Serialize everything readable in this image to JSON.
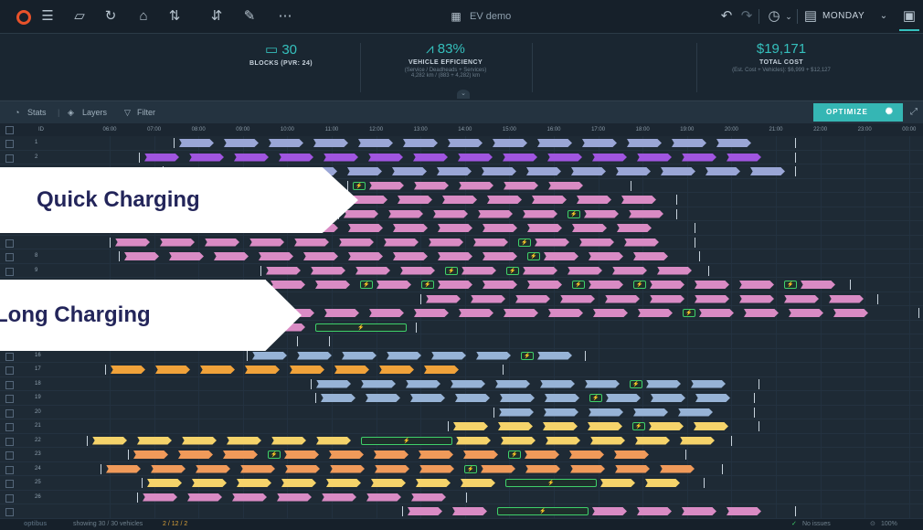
{
  "topbar": {
    "title": "EV demo",
    "day": "MONDAY",
    "icons": [
      "logo-icon",
      "menu-icon",
      "folder-icon",
      "refresh-icon",
      "building-icon",
      "sort-icon",
      "number-sort-icon",
      "pencil-icon",
      "more-icon"
    ],
    "right_icons": [
      "undo-icon",
      "redo-icon",
      "clock-icon",
      "document-icon",
      "bus-icon"
    ]
  },
  "stats": {
    "blocks": {
      "value": "30",
      "label": "BLOCKS (PVR: 24)"
    },
    "efficiency": {
      "value": "83%",
      "label": "VEHICLE EFFICIENCY",
      "sub1": "(Service / Deadheads + Services)",
      "sub2": "4,282 km / (883 + 4,282) km"
    },
    "cost": {
      "value": "$19,171",
      "label": "TOTAL COST",
      "sub": "(Est. Cost + Vehicles): $6,999 + $12,127"
    }
  },
  "toolbar": {
    "stats": "Stats",
    "layers": "Layers",
    "filter": "Filter",
    "optimize": "OPTIMIZE"
  },
  "timeline": {
    "id_header": "ID",
    "hours": [
      "06:00",
      "07:00",
      "08:00",
      "09:00",
      "10:00",
      "11:00",
      "12:00",
      "13:00",
      "14:00",
      "15:00",
      "16:00",
      "17:00",
      "18:00",
      "19:00",
      "20:00",
      "21:00",
      "22:00",
      "23:00",
      "00:00"
    ]
  },
  "rows": [
    "1",
    "2",
    "",
    "",
    "",
    "",
    "",
    "",
    "8",
    "9",
    "10",
    "",
    "",
    "",
    "",
    "16",
    "17",
    "18",
    "19",
    "20",
    "21",
    "22",
    "23",
    "24",
    "25",
    "26",
    ""
  ],
  "callouts": {
    "quick": "Quick Charging",
    "long": "Long Charging"
  },
  "footer": {
    "brand": "optibus",
    "schedule": "showing 30 / 30 vehicles",
    "warnings": "2 / 12 / 2",
    "status": "No issues",
    "zoom": "100%"
  },
  "colors": {
    "accent": "#35c0bd",
    "charge": "#3fd06a",
    "purple": "#a055e0",
    "pink": "#d98bc4",
    "lavender": "#9aa6d6",
    "orange": "#f0a23a",
    "yellow": "#f5d36a",
    "peach": "#f09a5a",
    "steel": "#97b3d6"
  }
}
